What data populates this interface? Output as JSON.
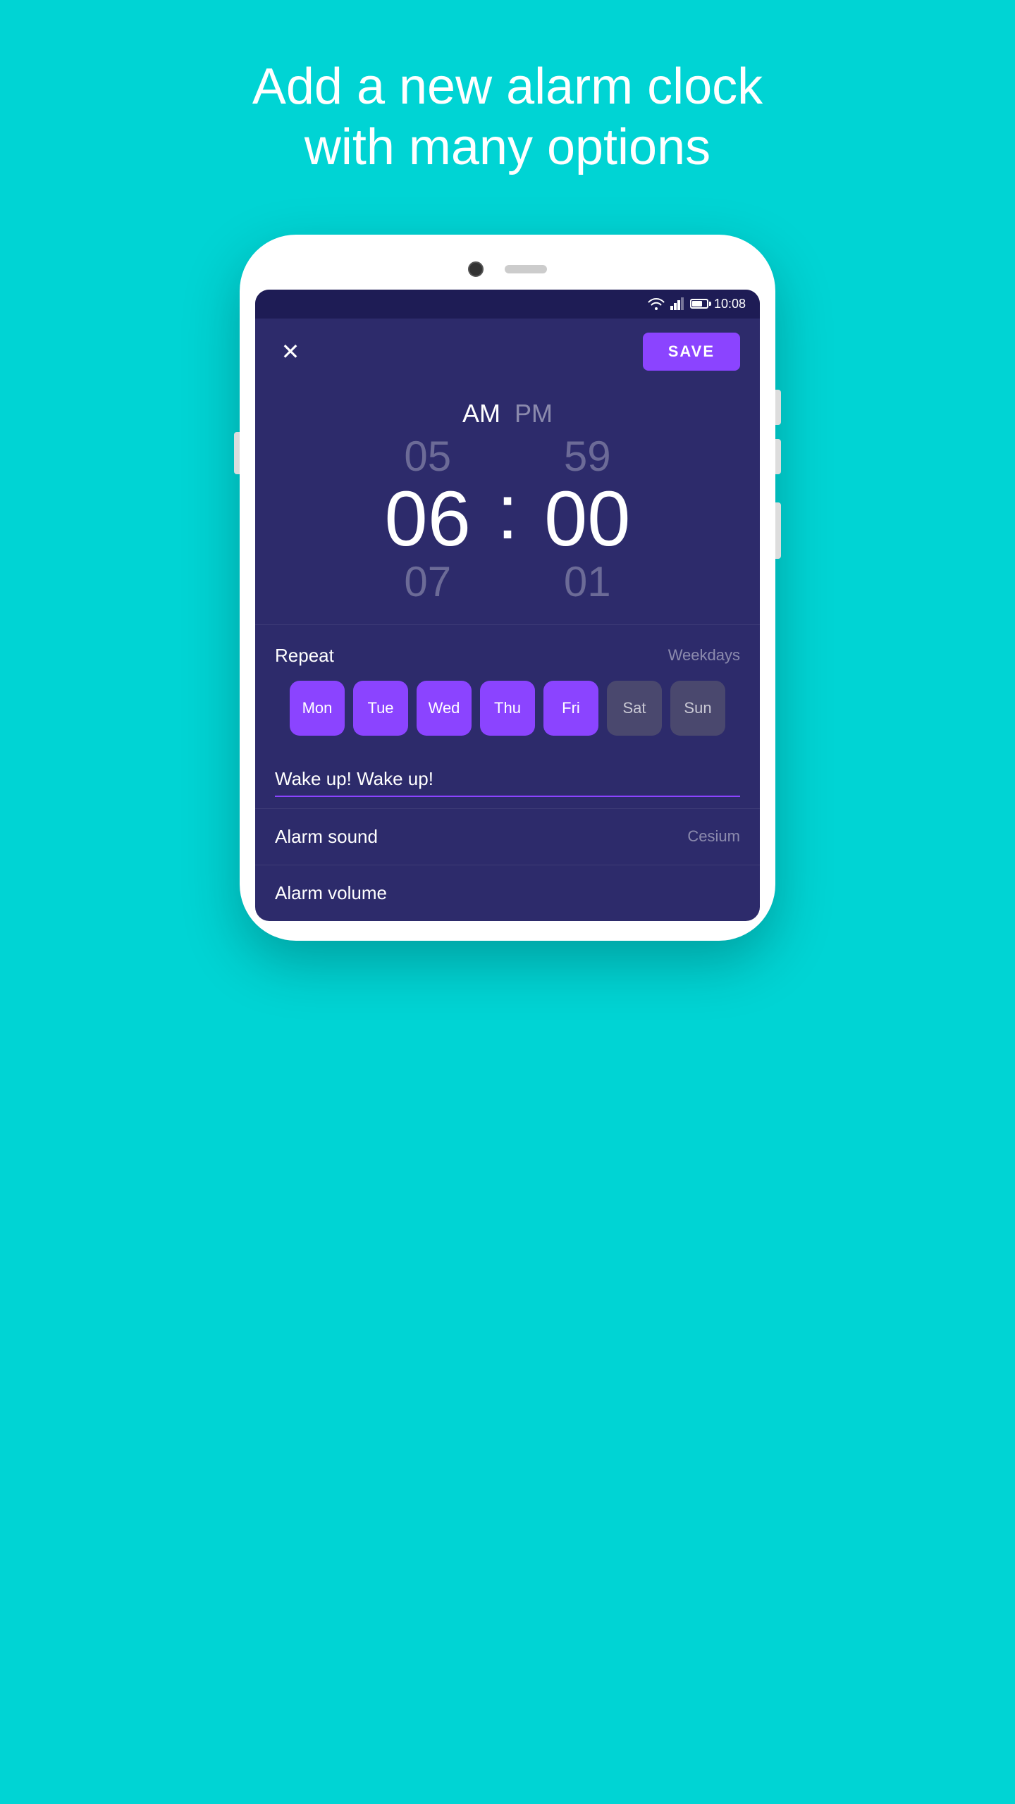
{
  "headline": {
    "line1": "Add a new alarm clock",
    "line2": "with many options"
  },
  "status_bar": {
    "time": "10:08"
  },
  "app_header": {
    "close_label": "✕",
    "save_label": "SAVE"
  },
  "time_picker": {
    "am_label": "AM",
    "pm_label": "PM",
    "hour_prev": "05",
    "hour_current": "06",
    "hour_next": "07",
    "minute_prev": "59",
    "minute_current": "00",
    "minute_next": "01",
    "colon": ":"
  },
  "repeat": {
    "label": "Repeat",
    "value": "Weekdays",
    "days": [
      {
        "label": "Mon",
        "active": true
      },
      {
        "label": "Tue",
        "active": true
      },
      {
        "label": "Wed",
        "active": true
      },
      {
        "label": "Thu",
        "active": true
      },
      {
        "label": "Fri",
        "active": true
      },
      {
        "label": "Sat",
        "active": false
      },
      {
        "label": "Sun",
        "active": false
      }
    ]
  },
  "alarm_name": {
    "value": "Wake up! Wake up!"
  },
  "alarm_sound": {
    "label": "Alarm sound",
    "value": "Cesium"
  },
  "alarm_volume": {
    "label": "Alarm volume"
  },
  "colors": {
    "bg": "#00D4D4",
    "screen_bg": "#2D2B6B",
    "accent": "#8B44FF"
  }
}
